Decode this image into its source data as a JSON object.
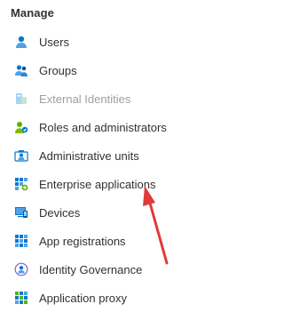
{
  "section": {
    "title": "Manage"
  },
  "nav": {
    "items": [
      {
        "label": "Users",
        "icon": "user-icon",
        "disabled": false
      },
      {
        "label": "Groups",
        "icon": "groups-icon",
        "disabled": false
      },
      {
        "label": "External Identities",
        "icon": "external-identities-icon",
        "disabled": true
      },
      {
        "label": "Roles and administrators",
        "icon": "roles-icon",
        "disabled": false
      },
      {
        "label": "Administrative units",
        "icon": "administrative-units-icon",
        "disabled": false
      },
      {
        "label": "Enterprise applications",
        "icon": "enterprise-applications-icon",
        "disabled": false
      },
      {
        "label": "Devices",
        "icon": "devices-icon",
        "disabled": false
      },
      {
        "label": "App registrations",
        "icon": "app-registrations-icon",
        "disabled": false
      },
      {
        "label": "Identity Governance",
        "icon": "identity-governance-icon",
        "disabled": false
      },
      {
        "label": "Application proxy",
        "icon": "application-proxy-icon",
        "disabled": false
      }
    ]
  },
  "colors": {
    "text": "#323130",
    "disabled_text": "#a19f9d",
    "icon_blue": "#0078d4",
    "icon_light_blue": "#50e6ff",
    "icon_green": "#5db300",
    "annotation_arrow": "#e03a3a"
  }
}
